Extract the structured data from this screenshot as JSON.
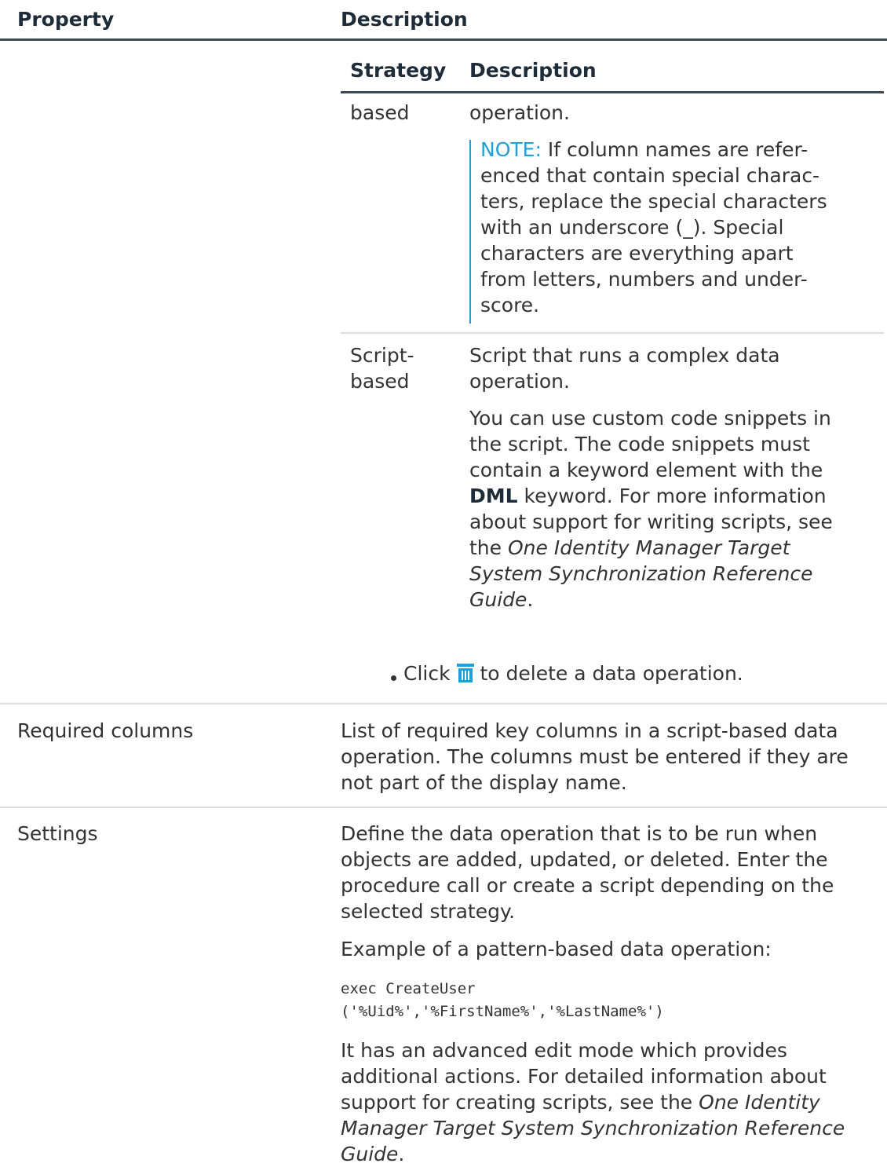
{
  "outer_table": {
    "headers": {
      "property": "Property",
      "description": "Description"
    }
  },
  "inner_table": {
    "headers": {
      "strategy": "Strategy",
      "description": "Description"
    },
    "row_pattern": {
      "strategy": "based",
      "desc": "operation.",
      "note_label": "NOTE:",
      "note_lines": [
        "If column names are refer-",
        "enced that contain special charac-",
        "ters, replace the special characters",
        "with an underscore (_). Special",
        "characters are everything apart",
        "from letters, numbers and under-",
        "score."
      ]
    },
    "row_script": {
      "strategy_lines": [
        "Script-",
        "based"
      ],
      "desc_lines": [
        "Script that runs a complex data",
        "operation."
      ],
      "para": {
        "line1": "You can use custom code snippets in",
        "line2": "the script. The code snippets must",
        "line3": "contain a keyword element with the",
        "line4_bold": "DML",
        "line4_rest": " keyword. For more information",
        "line5": "about support for writing scripts, see",
        "line6_pre": "the ",
        "line6_italic": "One Identity Manager Target",
        "line7_italic": "System Synchronization Reference",
        "line8_italic": "Guide",
        "line8_rest": "."
      }
    }
  },
  "bullet": {
    "pre": "Click ",
    "icon": "trash-icon",
    "post": " to delete a data operation."
  },
  "rows": {
    "required_columns": {
      "property": "Required columns",
      "lines": [
        "List of required key columns in a script-based data",
        "operation. The columns must be entered if they are",
        "not part of the display name."
      ]
    },
    "settings": {
      "property": "Settings",
      "para1": [
        "Define the data operation that is to be run when",
        "objects are added, updated, or deleted. Enter the",
        "procedure call or create a script depending on the",
        "selected strategy."
      ],
      "para2": "Example of a pattern-based data operation:",
      "code": [
        "exec CreateUser",
        "('%Uid%','%FirstName%','%LastName%')"
      ],
      "para3": {
        "line1": "It has an advanced edit mode which provides",
        "line2": "additional actions. For detailed information about",
        "line3_pre": "support for creating scripts, see the ",
        "line3_italic": "One Identity",
        "line4_italic": "Manager Target System Synchronization Reference",
        "line5_italic": "Guide",
        "line5_rest": "."
      }
    }
  },
  "colors": {
    "accent": "#1fa0d8",
    "header_text": "#1e2b38",
    "body_text": "#333333",
    "rule": "#3c4a56"
  }
}
